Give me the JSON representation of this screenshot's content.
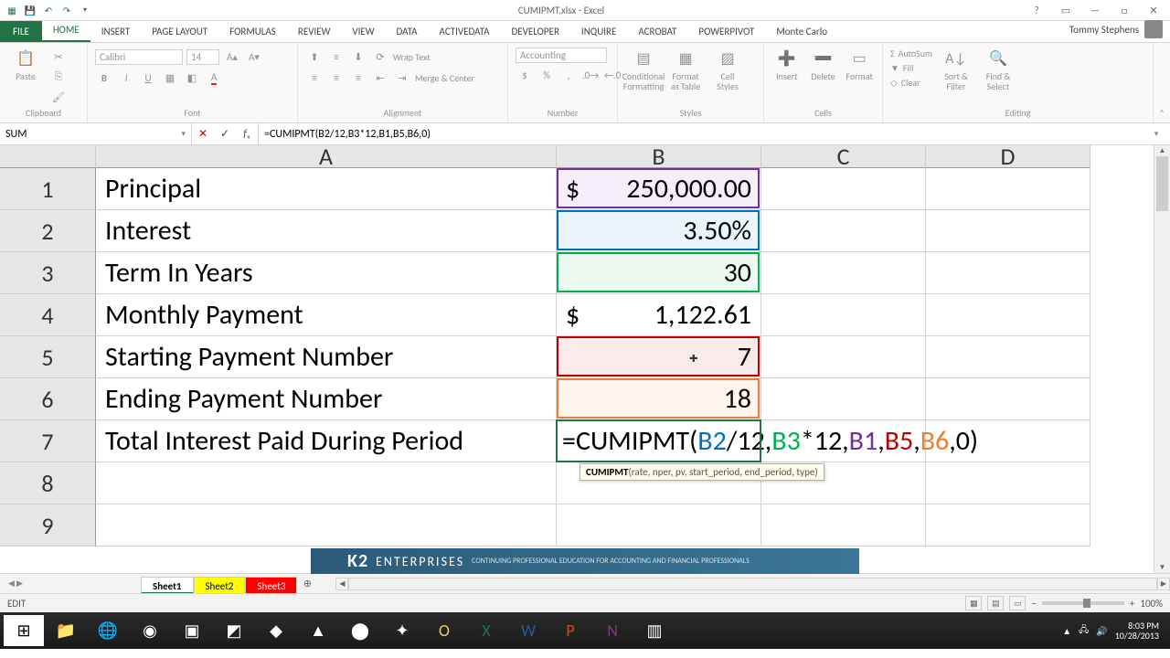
{
  "title": "CUMIPMT.xlsx - Excel",
  "user_name": "Tommy Stephens",
  "ribbon_tabs": [
    "HOME",
    "INSERT",
    "PAGE LAYOUT",
    "FORMULAS",
    "REVIEW",
    "VIEW",
    "DATA",
    "ACTIVEDATA",
    "DEVELOPER",
    "INQUIRE",
    "ACROBAT",
    "POWERPIVOT",
    "Monte Carlo"
  ],
  "active_tab": "HOME",
  "ribbon": {
    "clipboard": {
      "label": "Clipboard",
      "paste": "Paste"
    },
    "font": {
      "label": "Font",
      "name": "Calibri",
      "size": "14"
    },
    "alignment": {
      "label": "Alignment",
      "wrap": "Wrap Text",
      "merge": "Merge & Center"
    },
    "number": {
      "label": "Number",
      "format": "Accounting"
    },
    "styles": {
      "label": "Styles",
      "conditional": "Conditional Formatting",
      "table": "Format as Table",
      "cell": "Cell Styles"
    },
    "cells": {
      "label": "Cells",
      "insert": "Insert",
      "delete": "Delete",
      "format": "Format"
    },
    "editing": {
      "label": "Editing",
      "autosum": "AutoSum",
      "fill": "Fill",
      "clear": "Clear",
      "sort": "Sort & Filter",
      "find": "Find & Select"
    }
  },
  "namebox": "SUM",
  "formula_bar": "=CUMIPMT(B2/12,B3*12,B1,B5,B6,0)",
  "columns": [
    "A",
    "B",
    "C",
    "D"
  ],
  "rows": {
    "1": {
      "A": "Principal",
      "B_sym": "$",
      "B": "250,000.00"
    },
    "2": {
      "A": "Interest",
      "B": "3.50%"
    },
    "3": {
      "A": "Term In Years",
      "B": "30"
    },
    "4": {
      "A": "Monthly Payment",
      "B_sym": "$",
      "B": "1,122.61"
    },
    "5": {
      "A": "Starting Payment Number",
      "B": "7"
    },
    "6": {
      "A": "Ending Payment Number",
      "B": "18"
    },
    "7": {
      "A": "Total Interest Paid During Period"
    }
  },
  "row7_formula": {
    "pre": "=CUMIPMT(",
    "t1": "B2",
    "t2": "/12,",
    "t3": "B3",
    "t4": "*12,",
    "t5": "B1",
    "t6": ",",
    "t7": "B5",
    "t8": ",",
    "t9": "B6",
    "t10": ",0)"
  },
  "tooltip": {
    "fn": "CUMIPMT",
    "sig": "(rate, nper, pv, start_period, end_period, type)"
  },
  "sheet_tabs": [
    {
      "name": "Sheet1",
      "color": "active"
    },
    {
      "name": "Sheet2",
      "color": "yellow"
    },
    {
      "name": "Sheet3",
      "color": "red"
    }
  ],
  "status": {
    "mode": "EDIT",
    "zoom": "100%"
  },
  "overlay": {
    "brand": "K2",
    "name": "ENTERPRISES",
    "tagline": "CONTINUING PROFESSIONAL EDUCATION FOR ACCOUNTING AND FINANCIAL PROFESSIONALS"
  },
  "clock": {
    "time": "8:03 PM",
    "date": "10/28/2013"
  }
}
